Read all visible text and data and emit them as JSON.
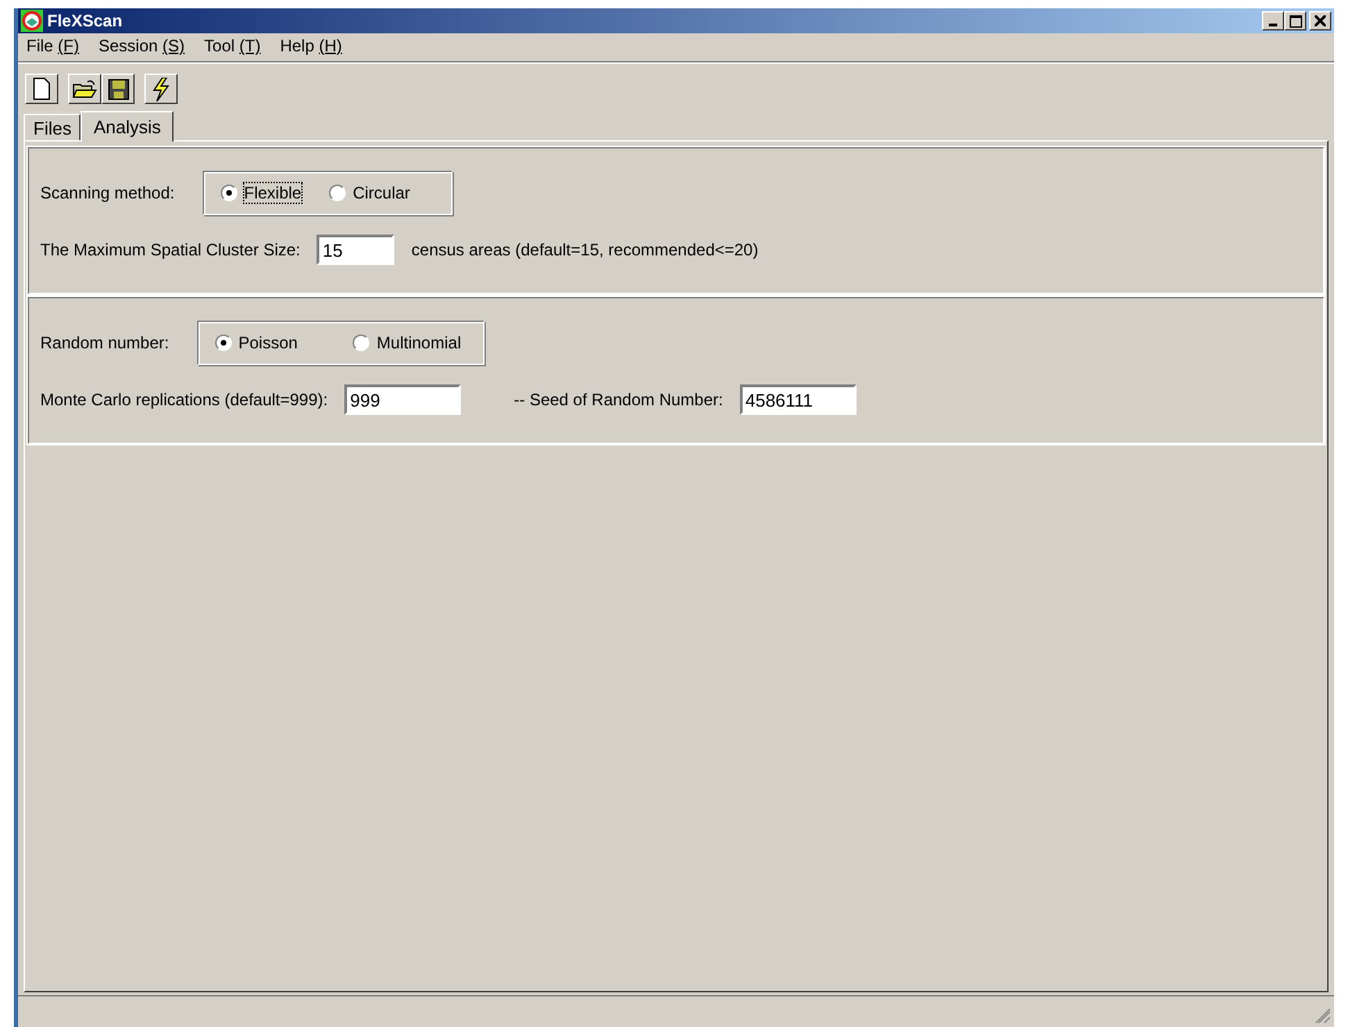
{
  "window": {
    "title": "FleXScan"
  },
  "menu": [
    {
      "label": "File",
      "key": "(F)"
    },
    {
      "label": "Session",
      "key": "(S)"
    },
    {
      "label": "Tool",
      "key": "(T)"
    },
    {
      "label": "Help",
      "key": "(H)"
    }
  ],
  "tabs": [
    {
      "label": "Files",
      "selected": false
    },
    {
      "label": "Analysis",
      "selected": true
    }
  ],
  "scanning": {
    "label": "Scanning method:",
    "options": [
      {
        "label": "Flexible",
        "selected": true
      },
      {
        "label": "Circular",
        "selected": false
      }
    ]
  },
  "cluster_size": {
    "label": "The Maximum Spatial Cluster Size:",
    "value": "15",
    "suffix": "census areas (default=15, recommended<=20)"
  },
  "random": {
    "label": "Random number:",
    "options": [
      {
        "label": "Poisson",
        "selected": true
      },
      {
        "label": "Multinomial",
        "selected": false
      }
    ]
  },
  "replications": {
    "label": "Monte Carlo replications (default=999):",
    "value": "999"
  },
  "seed": {
    "label": "-- Seed of Random Number:",
    "value": "4586111"
  }
}
